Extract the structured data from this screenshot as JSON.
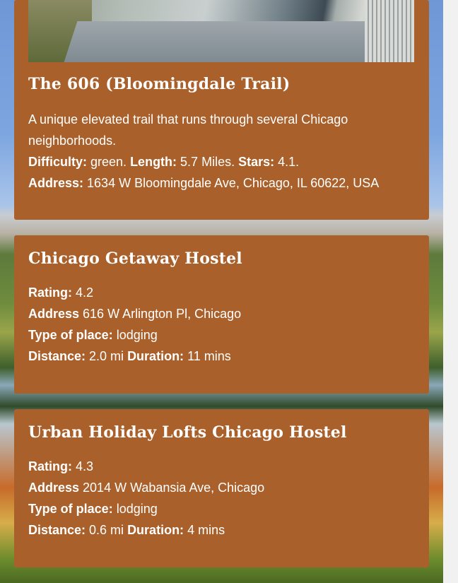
{
  "trail": {
    "title": "The 606 (Bloomingdale Trail)",
    "description": "A unique elevated trail that runs through several Chicago neighborhoods.",
    "difficulty_label": "Difficulty:",
    "difficulty_value": " green.",
    "length_label": "Length:",
    "length_value": " 5.7 Miles.",
    "stars_label": "Stars:",
    "stars_value": " 4.1.",
    "address_label": "Address:",
    "address_value": " 1634 W Bloomingdale Ave, Chicago, IL 60622, USA"
  },
  "hostels": [
    {
      "name": "Chicago Getaway Hostel",
      "rating_label": "Rating:",
      "rating_value": " 4.2",
      "address_label": "Address",
      "address_value": " 616 W Arlington Pl, Chicago",
      "type_label": "Type of place:",
      "type_value": " lodging",
      "distance_label": "Distance:",
      "distance_value": " 2.0 mi ",
      "duration_label": "Duration:",
      "duration_value": " 11 mins"
    },
    {
      "name": "Urban Holiday Lofts Chicago Hostel",
      "rating_label": "Rating:",
      "rating_value": " 4.3",
      "address_label": "Address",
      "address_value": " 2014 W Wabansia Ave, Chicago",
      "type_label": "Type of place:",
      "type_value": " lodging",
      "distance_label": "Distance:",
      "distance_value": " 0.6 mi ",
      "duration_label": "Duration:",
      "duration_value": " 4 mins"
    }
  ],
  "colors": {
    "card": "#a9602a",
    "text": "#ffffff"
  }
}
